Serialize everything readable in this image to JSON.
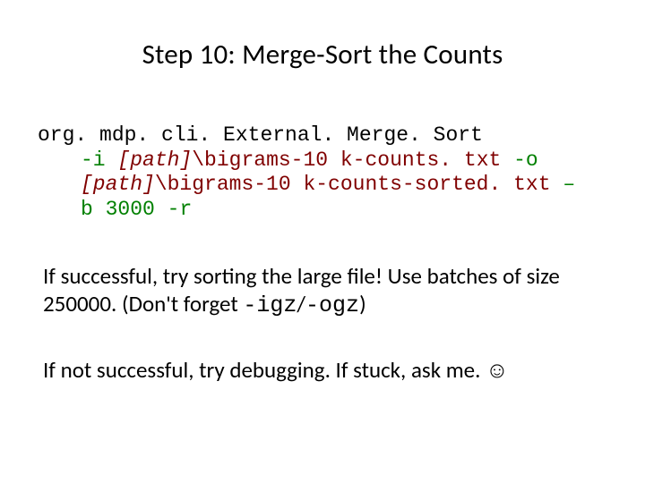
{
  "title": "Step 10: Merge-Sort the Counts",
  "code": {
    "class": "org. mdp. cli. External. Merge. Sort",
    "flag_i": "-i",
    "path1": "[path]",
    "arg1": "\\bigrams-10 k-counts. txt",
    "flag_o": "-o",
    "path2": "[path]",
    "arg2": "\\bigrams-10 k-counts-sorted. txt",
    "endash": "–",
    "b_line": "b 3000",
    "flag_r": "-r"
  },
  "para1": {
    "pre": "If successful, try sorting the large file! Use batches of size 250000. (Don't forget ",
    "igz": "-igz",
    "slash": "/",
    "ogz": "-ogz",
    "post": ")"
  },
  "para2": "If not successful, try debugging. If stuck, ask me. ☺"
}
